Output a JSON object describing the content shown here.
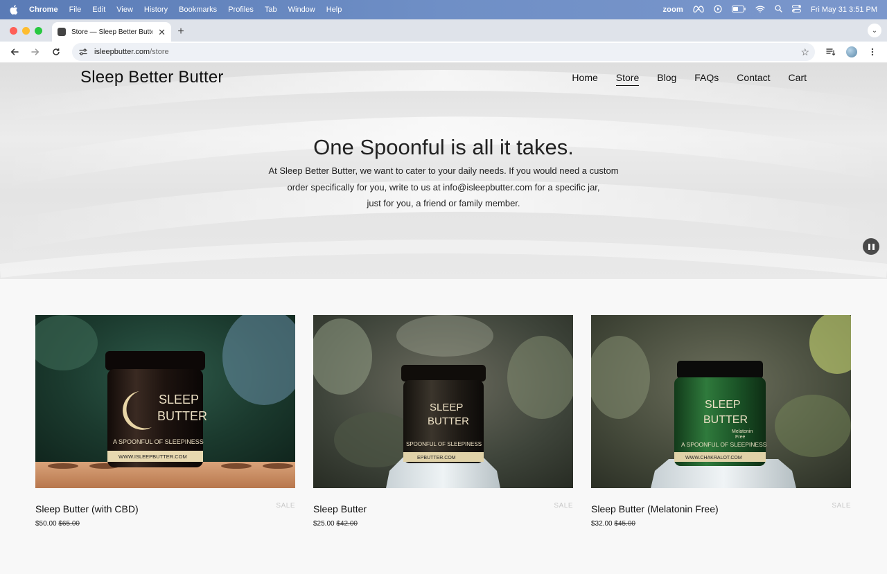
{
  "menubar": {
    "app": "Chrome",
    "items": [
      "File",
      "Edit",
      "View",
      "History",
      "Bookmarks",
      "Profiles",
      "Tab",
      "Window",
      "Help"
    ],
    "zoom_label": "zoom",
    "datetime": "Fri May 31  3:51 PM"
  },
  "browser": {
    "tab_title": "Store — Sleep Better Butter",
    "url_host": "isleepbutter.com",
    "url_path": "/store"
  },
  "site": {
    "title": "Sleep Better Butter",
    "nav": [
      {
        "label": "Home",
        "active": false
      },
      {
        "label": "Store",
        "active": true
      },
      {
        "label": "Blog",
        "active": false
      },
      {
        "label": "FAQs",
        "active": false
      },
      {
        "label": "Contact",
        "active": false
      },
      {
        "label": "Cart",
        "active": false
      }
    ],
    "hero_heading": "One Spoonful is all it takes.",
    "hero_lines": [
      "At Sleep Better Butter, we want to cater to your daily needs. If you would need a custom",
      "order specifically for you, write to us at info@isleepbutter.com for a specific jar,",
      "just for you, a friend or family member."
    ]
  },
  "products": [
    {
      "name": "Sleep Butter (with CBD)",
      "badge": "SALE",
      "price": "$50.00",
      "original_price": "$65.00",
      "jar_color": "#2a1c16",
      "label_text": [
        "SLEEP",
        "BUTTER"
      ],
      "tagline": "A SPOONFUL OF SLEEPINESS",
      "site_text": "WWW.ISLEEPBUTTER.COM"
    },
    {
      "name": "Sleep Butter",
      "badge": "SALE",
      "price": "$25.00",
      "original_price": "$42.00",
      "jar_color": "#2b2620",
      "label_text": [
        "SLEEP",
        "BUTTER"
      ],
      "tagline": "SPOONFUL OF SLEEPINESS",
      "site_text": "EPBUTTER.COM"
    },
    {
      "name": "Sleep Butter (Melatonin Free)",
      "badge": "SALE",
      "price": "$32.00",
      "original_price": "$45.00",
      "jar_color": "#1f5a2a",
      "label_text": [
        "SLEEP",
        "BUTTER"
      ],
      "tagline": "A SPOONFUL OF SLEEPINESS",
      "site_text": "WWW.CHAKRALOT.COM",
      "extra_text": "Melatonin Free"
    }
  ],
  "colors": {
    "menubar": "#6f8fc6",
    "accent_underline": "#111111",
    "sale_badge": "#c8c8c8"
  }
}
